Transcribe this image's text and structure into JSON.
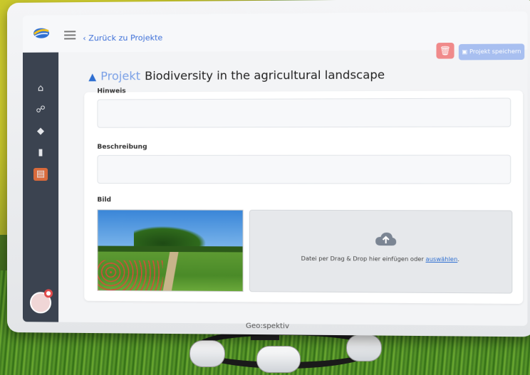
{
  "header": {
    "back_label": "Zurück zu Projekte",
    "save_label": "Projekt speichern"
  },
  "page": {
    "title_prefix": "Projekt",
    "title": "Biodiversity in the agricultural landscape"
  },
  "form": {
    "hint_label": "Hinweis",
    "description_label": "Beschreibung",
    "image_label": "Bild",
    "dropzone_text": "Datei per Drag & Drop hier einfügen oder",
    "dropzone_link": "auswählen",
    "dropzone_period": "."
  },
  "sidebar": {
    "items": [
      {
        "icon": "home-icon"
      },
      {
        "icon": "network-icon"
      },
      {
        "icon": "tags-icon"
      },
      {
        "icon": "document-icon"
      },
      {
        "icon": "archive-icon"
      }
    ]
  },
  "brand": "Geo:spektiv",
  "colors": {
    "accent": "#3d6fd8",
    "sidebar": "#3b4350",
    "active_item": "#d96a3b",
    "delete": "#f08a8a",
    "save": "#a8bff0"
  }
}
